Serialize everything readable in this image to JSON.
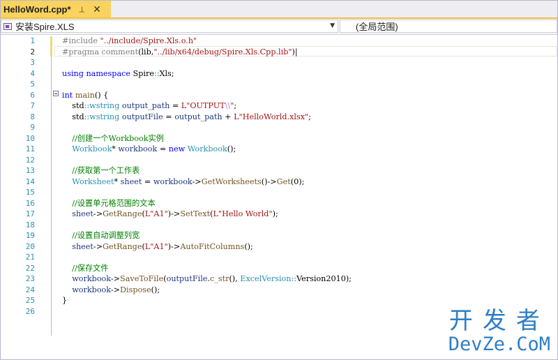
{
  "tab": {
    "title": "HelloWord.cpp*",
    "pin_glyph": "⊣",
    "close_glyph": "✕"
  },
  "navbar": {
    "project": "安装Spire.XLS",
    "scope": "(全局范围)",
    "dropdown_glyph": "▼"
  },
  "editor": {
    "current_line": 2,
    "lines": [
      {
        "n": "1"
      },
      {
        "n": "2"
      },
      {
        "n": "3"
      },
      {
        "n": "4"
      },
      {
        "n": "5"
      },
      {
        "n": "6"
      },
      {
        "n": "7"
      },
      {
        "n": "8"
      },
      {
        "n": "9"
      },
      {
        "n": "10"
      },
      {
        "n": "11"
      },
      {
        "n": "12"
      },
      {
        "n": "13"
      },
      {
        "n": "14"
      },
      {
        "n": "15"
      },
      {
        "n": "16"
      },
      {
        "n": "17"
      },
      {
        "n": "18"
      },
      {
        "n": "19"
      },
      {
        "n": "20"
      },
      {
        "n": "21"
      },
      {
        "n": "22"
      },
      {
        "n": "23"
      },
      {
        "n": "24"
      },
      {
        "n": "25"
      },
      {
        "n": "26"
      }
    ],
    "code": [
      [
        {
          "c": "pp",
          "t": "#include "
        },
        {
          "c": "s",
          "t": "\"../include/Spire.Xls.o.h\""
        }
      ],
      [
        {
          "c": "pp",
          "t": "#pragma comment"
        },
        {
          "c": "n",
          "t": "(lib,"
        },
        {
          "c": "s",
          "t": "\"../lib/x64/debug/Spire.Xls.Cpp.lib\""
        },
        {
          "c": "n",
          "t": ")|"
        }
      ],
      [],
      [
        {
          "c": "k",
          "t": "using namespace "
        },
        {
          "c": "n",
          "t": "Spire"
        },
        {
          "c": "o",
          "t": "::"
        },
        {
          "c": "n",
          "t": "Xls;"
        }
      ],
      [],
      [
        {
          "c": "k",
          "t": "int "
        },
        {
          "c": "f",
          "t": "main"
        },
        {
          "c": "n",
          "t": "() {"
        }
      ],
      [
        {
          "c": "n",
          "t": "    std"
        },
        {
          "c": "o",
          "t": "::"
        },
        {
          "c": "t",
          "t": "wstring "
        },
        {
          "c": "v",
          "t": "output_path"
        },
        {
          "c": "n",
          "t": " = "
        },
        {
          "c": "s",
          "t": "L\"OUTPUT"
        },
        {
          "c": "e",
          "t": "\\\\"
        },
        {
          "c": "s",
          "t": "\""
        },
        {
          "c": "n",
          "t": ";"
        }
      ],
      [
        {
          "c": "n",
          "t": "    std"
        },
        {
          "c": "o",
          "t": "::"
        },
        {
          "c": "t",
          "t": "wstring "
        },
        {
          "c": "v",
          "t": "outputFile"
        },
        {
          "c": "n",
          "t": " = "
        },
        {
          "c": "v",
          "t": "output_path"
        },
        {
          "c": "n",
          "t": " + "
        },
        {
          "c": "s",
          "t": "L\"HelloWorld.xlsx\""
        },
        {
          "c": "n",
          "t": ";"
        }
      ],
      [],
      [
        {
          "c": "c",
          "t": "    //创建一个Workbook实例"
        }
      ],
      [
        {
          "c": "t",
          "t": "    Workbook"
        },
        {
          "c": "n",
          "t": "* "
        },
        {
          "c": "v",
          "t": "workbook"
        },
        {
          "c": "n",
          "t": " = "
        },
        {
          "c": "k",
          "t": "new "
        },
        {
          "c": "t",
          "t": "Workbook"
        },
        {
          "c": "n",
          "t": "();"
        }
      ],
      [],
      [
        {
          "c": "c",
          "t": "    //获取第一个工作表"
        }
      ],
      [
        {
          "c": "t",
          "t": "    Worksheet"
        },
        {
          "c": "n",
          "t": "* "
        },
        {
          "c": "v",
          "t": "sheet"
        },
        {
          "c": "n",
          "t": " = "
        },
        {
          "c": "v",
          "t": "workbook"
        },
        {
          "c": "n",
          "t": "->"
        },
        {
          "c": "f",
          "t": "GetWorksheets"
        },
        {
          "c": "n",
          "t": "()->"
        },
        {
          "c": "f",
          "t": "Get"
        },
        {
          "c": "n",
          "t": "(0);"
        }
      ],
      [],
      [
        {
          "c": "c",
          "t": "    //设置单元格范围的文本"
        }
      ],
      [
        {
          "c": "v",
          "t": "    sheet"
        },
        {
          "c": "n",
          "t": "->"
        },
        {
          "c": "f",
          "t": "GetRange"
        },
        {
          "c": "n",
          "t": "("
        },
        {
          "c": "s",
          "t": "L\"A1\""
        },
        {
          "c": "n",
          "t": ")->"
        },
        {
          "c": "f",
          "t": "SetText"
        },
        {
          "c": "n",
          "t": "("
        },
        {
          "c": "s",
          "t": "L\"Hello World\""
        },
        {
          "c": "n",
          "t": ");"
        }
      ],
      [],
      [
        {
          "c": "c",
          "t": "    //设置自动调整列宽"
        }
      ],
      [
        {
          "c": "v",
          "t": "    sheet"
        },
        {
          "c": "n",
          "t": "->"
        },
        {
          "c": "f",
          "t": "GetRange"
        },
        {
          "c": "n",
          "t": "("
        },
        {
          "c": "s",
          "t": "L\"A1\""
        },
        {
          "c": "n",
          "t": ")->"
        },
        {
          "c": "f",
          "t": "AutoFitColumns"
        },
        {
          "c": "n",
          "t": "();"
        }
      ],
      [],
      [
        {
          "c": "c",
          "t": "    //保存文件"
        }
      ],
      [
        {
          "c": "v",
          "t": "    workbook"
        },
        {
          "c": "n",
          "t": "->"
        },
        {
          "c": "f",
          "t": "SaveToFile"
        },
        {
          "c": "n",
          "t": "("
        },
        {
          "c": "v",
          "t": "outputFile"
        },
        {
          "c": "n",
          "t": "."
        },
        {
          "c": "f",
          "t": "c_str"
        },
        {
          "c": "n",
          "t": "(), "
        },
        {
          "c": "t",
          "t": "ExcelVersion"
        },
        {
          "c": "o",
          "t": "::"
        },
        {
          "c": "n",
          "t": "Version2010);"
        }
      ],
      [
        {
          "c": "v",
          "t": "    workbook"
        },
        {
          "c": "n",
          "t": "->"
        },
        {
          "c": "f",
          "t": "Dispose"
        },
        {
          "c": "n",
          "t": "();"
        }
      ],
      [
        {
          "c": "n",
          "t": "}"
        }
      ],
      []
    ]
  },
  "watermark": {
    "cn": "开发者",
    "en": "DevZe.CoM"
  }
}
